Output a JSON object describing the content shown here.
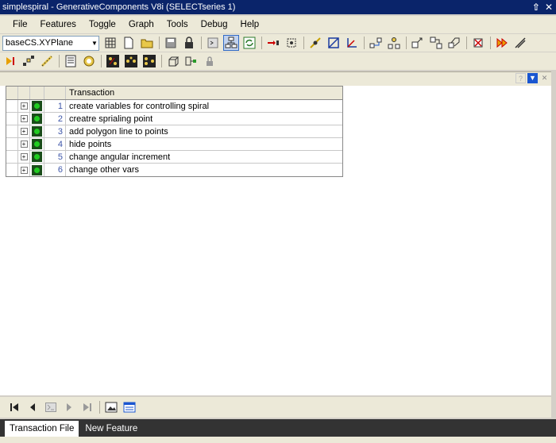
{
  "window": {
    "title": "simplespiral - GenerativeComponents V8i (SELECTseries 1)",
    "pin_glyph": "⇧",
    "close_glyph": "✕"
  },
  "menu": [
    "File",
    "Features",
    "Toggle",
    "Graph",
    "Tools",
    "Debug",
    "Help"
  ],
  "toolbar": {
    "plane_combo": "baseCS.XYPlane",
    "tb1_icons": [
      "grid-plane-icon",
      "new-file-icon",
      "open-folder-icon",
      "save-icon",
      "lock-save-icon",
      "script-icon",
      "symbolic-graph-icon",
      "refresh-icon",
      "create-feature-icon",
      "select-icon",
      "point-icon",
      "plane-icon",
      "axis-icon",
      "node-link-icon",
      "node-tree-icon",
      "move-node-icon",
      "nodes-icon",
      "nodes2-icon",
      "delete-icon",
      "play-icon",
      "line-tool-icon"
    ],
    "tb2_icons": [
      "run-step-icon",
      "network-icon",
      "measure-icon",
      "report-icon",
      "cycle-icon",
      "yellow-points-icon",
      "points-grid-icon",
      "points-row-icon",
      "cube-icon",
      "variable-icon",
      "lock-icon"
    ]
  },
  "panel": {
    "help_glyph": "?",
    "menu_glyph": "▼",
    "close_glyph": "✕"
  },
  "transactions": {
    "header": "Transaction",
    "expander": "+",
    "rows": [
      {
        "num": "1",
        "desc": "create variables for controlling spiral"
      },
      {
        "num": "2",
        "desc": "creatre sprialing point"
      },
      {
        "num": "3",
        "desc": "add polygon line to points"
      },
      {
        "num": "4",
        "desc": "hide points"
      },
      {
        "num": "5",
        "desc": "change angular increment"
      },
      {
        "num": "6",
        "desc": "change other vars"
      }
    ]
  },
  "navigation": {
    "first": "⏮",
    "prev": "◀",
    "step": "▤",
    "next": "▶",
    "last": "⏭",
    "image": "▣",
    "panel": "☰"
  },
  "tabs": [
    "Transaction File",
    "New Feature"
  ],
  "colors": {
    "titlebar": "#0a246a",
    "led_green": "#22cc22",
    "row_number": "#3d55a8"
  }
}
